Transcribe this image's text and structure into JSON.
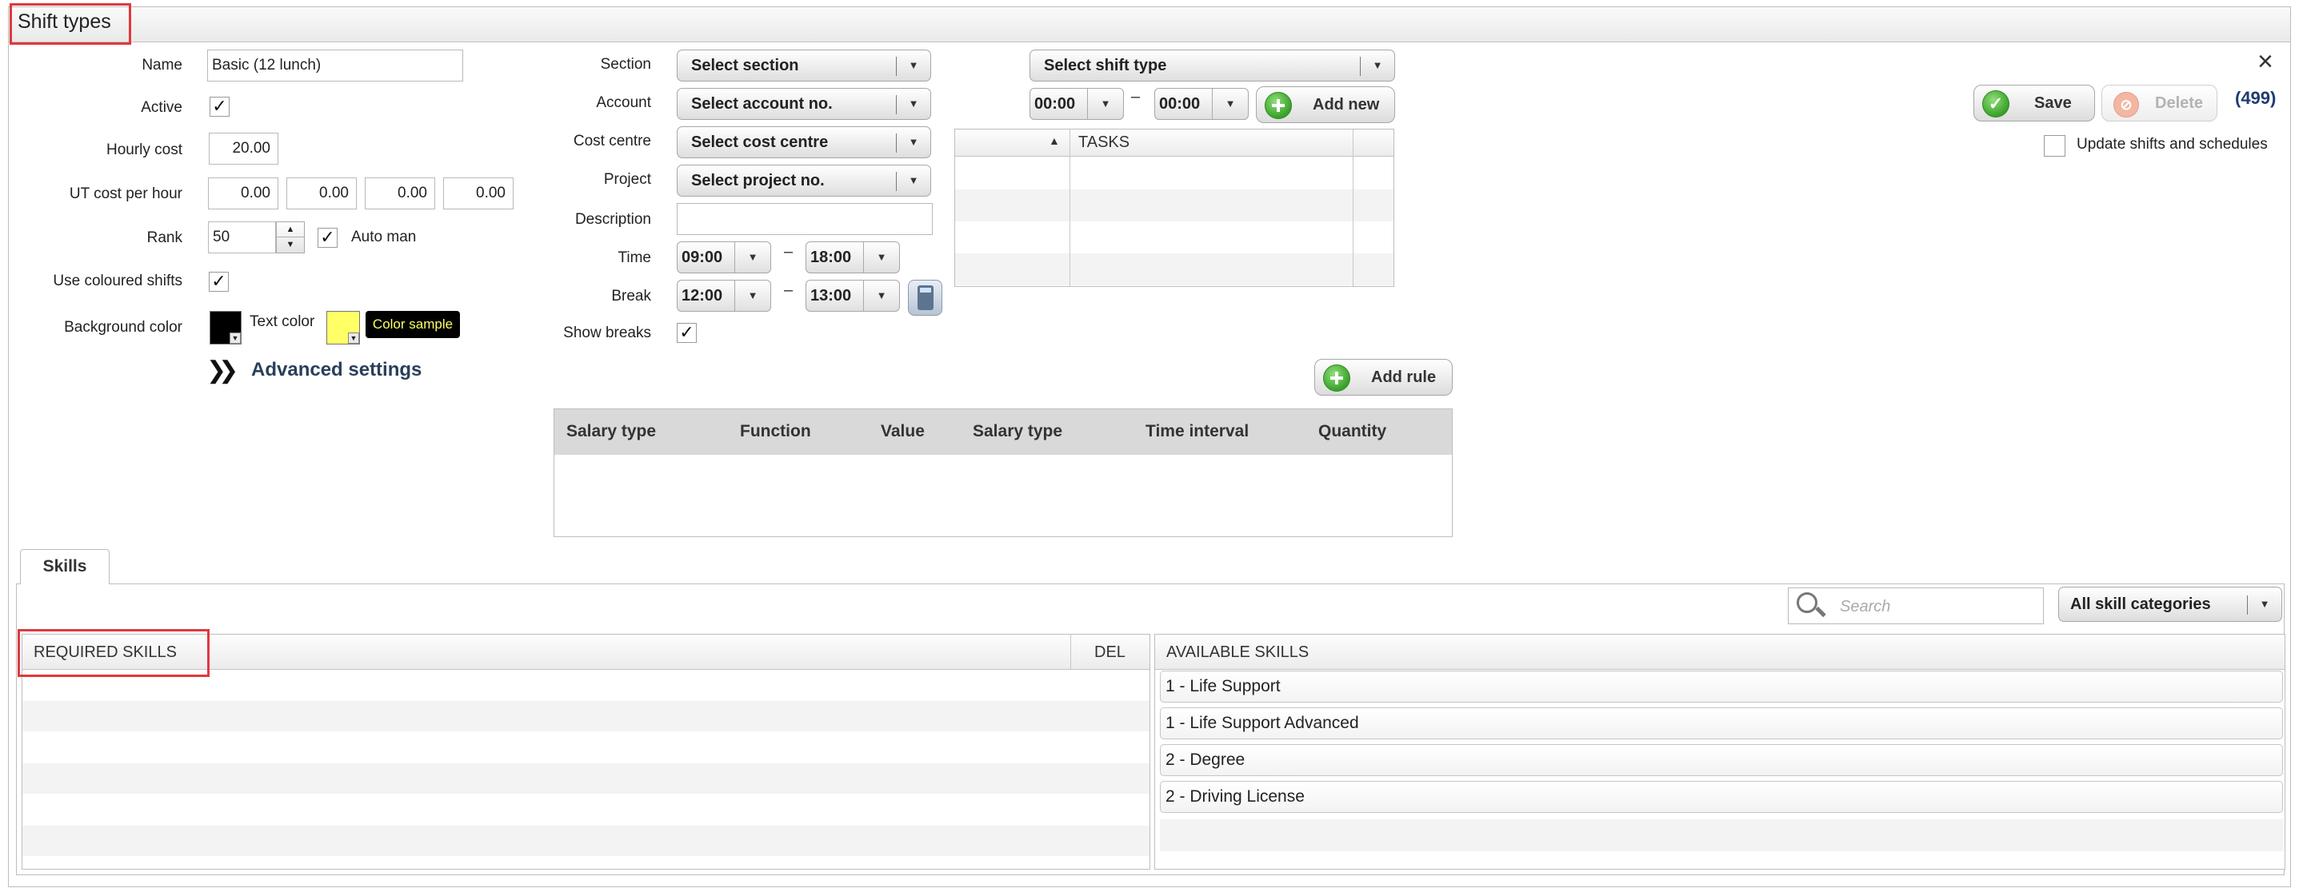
{
  "window": {
    "title": "Shift types"
  },
  "form": {
    "name_label": "Name",
    "name_value": "Basic (12 lunch)",
    "active_label": "Active",
    "hourly_cost_label": "Hourly cost",
    "hourly_cost_value": "20.00",
    "ut_cost_label": "UT cost per hour",
    "ut_cost_values": [
      "0.00",
      "0.00",
      "0.00",
      "0.00"
    ],
    "rank_label": "Rank",
    "rank_value": "50",
    "auto_man_label": "Auto man",
    "use_coloured_label": "Use coloured shifts",
    "bg_color_label": "Background color",
    "text_color_label": "Text color",
    "color_sample_label": "Color sample",
    "advanced_settings_label": "Advanced settings"
  },
  "middle": {
    "section_label": "Section",
    "section_value": "Select section",
    "account_label": "Account",
    "account_value": "Select account no.",
    "cost_centre_label": "Cost centre",
    "cost_centre_value": "Select cost centre",
    "project_label": "Project",
    "project_value": "Select project no.",
    "description_label": "Description",
    "description_value": "",
    "time_label": "Time",
    "time_from": "09:00",
    "time_to": "18:00",
    "break_label": "Break",
    "break_from": "12:00",
    "break_to": "13:00",
    "show_breaks_label": "Show breaks",
    "dash": "–"
  },
  "tasks": {
    "shift_type_select": "Select shift type",
    "time_from": "00:00",
    "time_to": "00:00",
    "add_new_label": "Add new",
    "sort_icon": "▲",
    "column_header": "TASKS"
  },
  "actions": {
    "save_label": "Save",
    "delete_label": "Delete",
    "count": "(499)",
    "update_label": "Update shifts and schedules",
    "close_symbol": "×"
  },
  "rules": {
    "add_rule_label": "Add rule",
    "columns": [
      "Salary type",
      "Function",
      "Value",
      "Salary type",
      "Time interval",
      "Quantity"
    ]
  },
  "skills": {
    "tab_label": "Skills",
    "search_placeholder": "Search",
    "category_select": "All skill categories",
    "required_header": "REQUIRED SKILLS",
    "del_header": "DEL",
    "available_header": "AVAILABLE SKILLS",
    "available": [
      "1 - Life Support",
      "1 - Life Support Advanced",
      "2 - Degree",
      "2 - Driving License"
    ]
  },
  "colors": {
    "highlight": "#e0393e",
    "bg_color": "#000000",
    "text_color": "#ffff66",
    "link": "#2a3f5a",
    "count": "#1f3b70"
  }
}
